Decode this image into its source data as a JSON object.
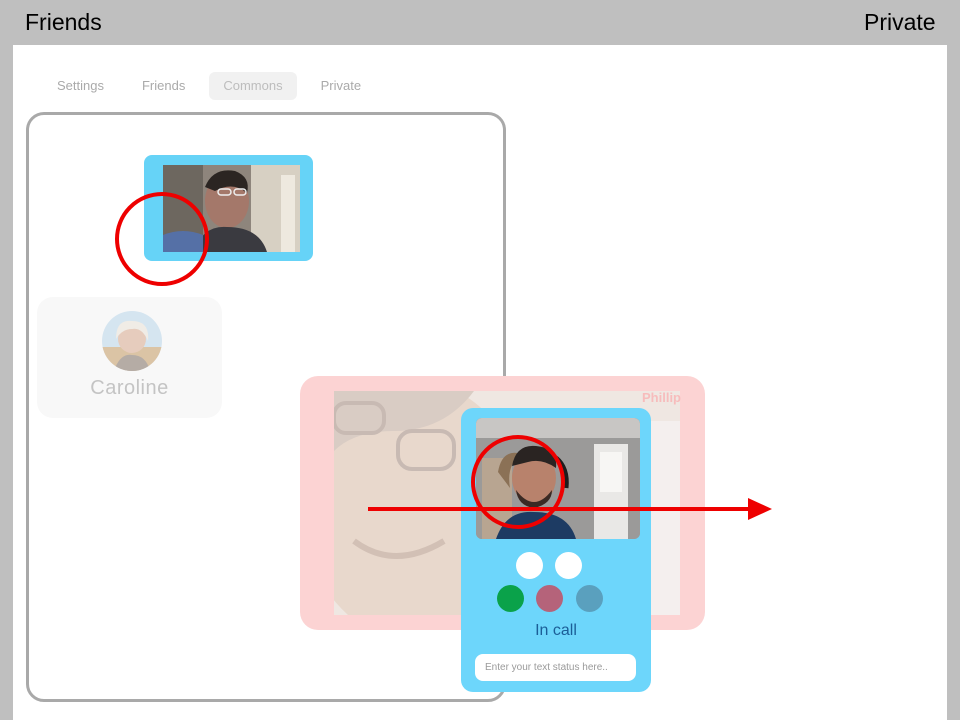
{
  "corners": {
    "left_label": "Friends",
    "right_label": "Private"
  },
  "tabs": [
    {
      "label": "Settings",
      "active": false
    },
    {
      "label": "Friends",
      "active": false
    },
    {
      "label": "Commons",
      "active": true
    },
    {
      "label": "Private",
      "active": false
    }
  ],
  "caroline": {
    "name": "Caroline"
  },
  "phillip": {
    "name": "Phillip"
  },
  "call_card": {
    "status": "In call",
    "status_placeholder": "Enter your text status here..",
    "controls": [
      {
        "icon": "white-dot-1",
        "color": "#ffffff"
      },
      {
        "icon": "white-dot-2",
        "color": "#ffffff"
      },
      {
        "icon": "green-dot",
        "color": "#0aa24a"
      },
      {
        "icon": "rose-dot",
        "color": "#b5637a"
      },
      {
        "icon": "teal-dot",
        "color": "#5aa0be"
      }
    ]
  },
  "colors": {
    "card_blue": "#66d3f7",
    "phillip_pink": "#fcd3d3",
    "annotation_red": "#ee0000"
  }
}
